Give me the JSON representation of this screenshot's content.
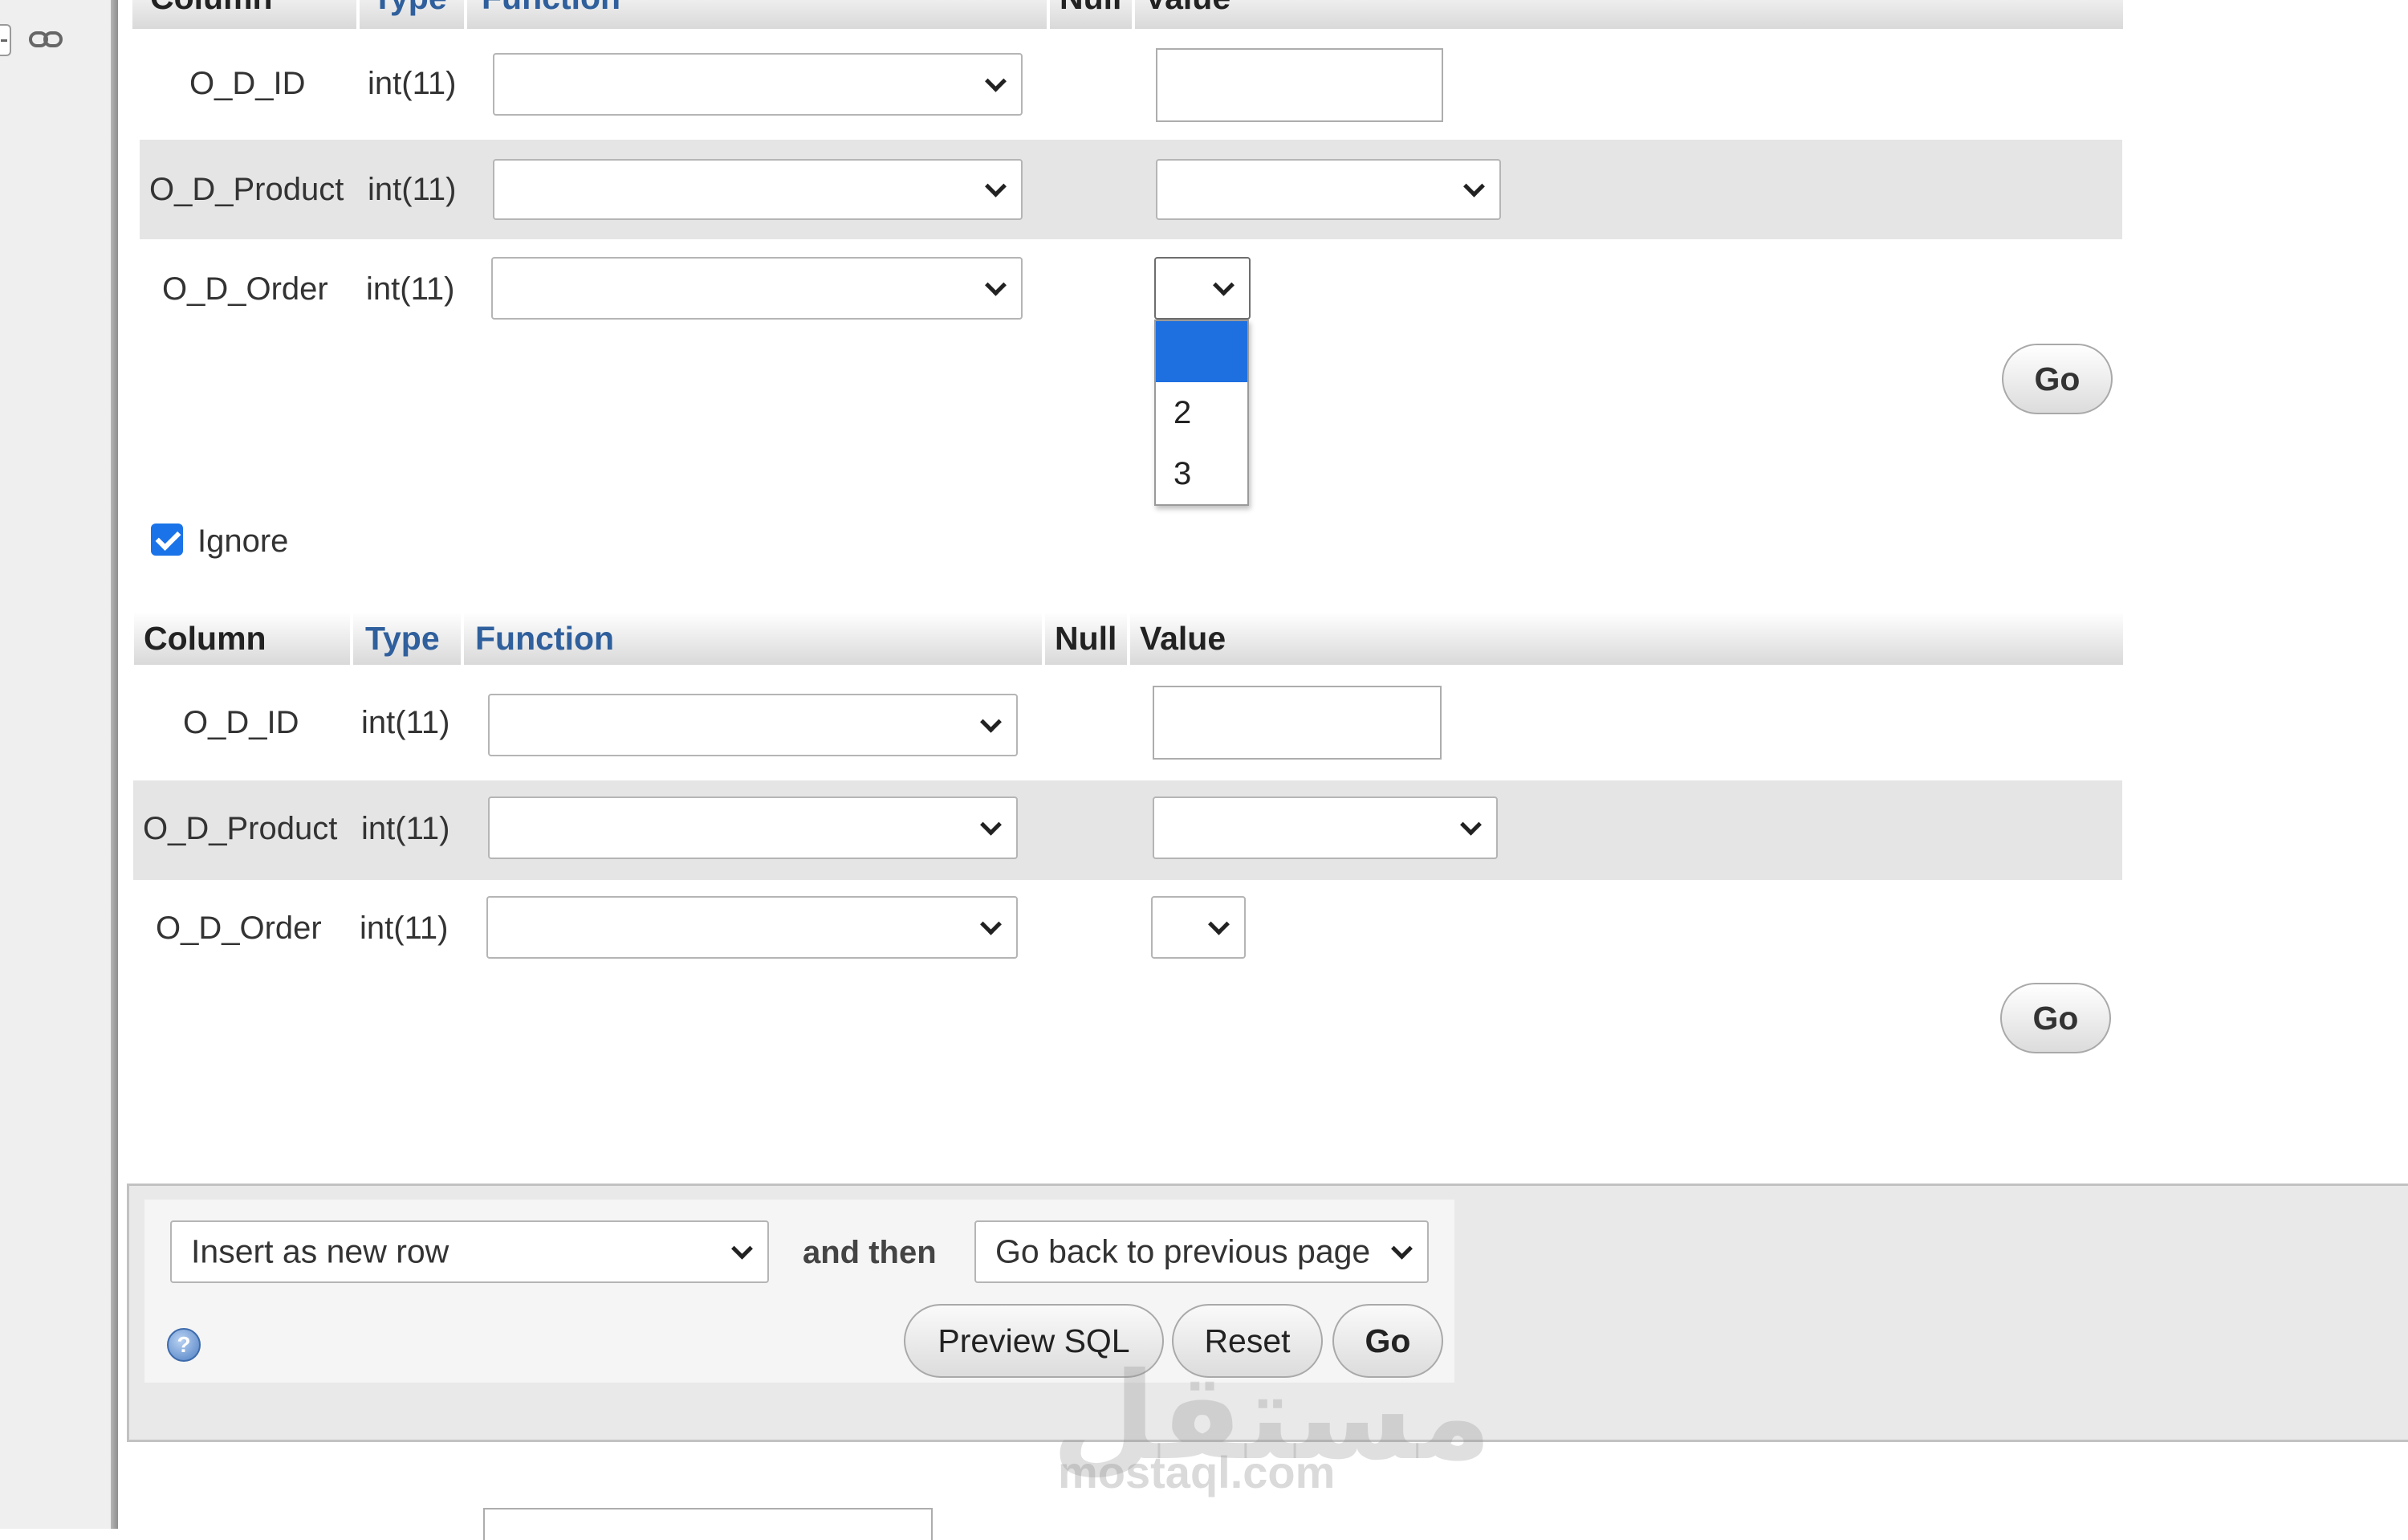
{
  "header": {
    "column": "Column",
    "type": "Type",
    "function": "Function",
    "null": "Null",
    "value": "Value"
  },
  "form1": {
    "rows": [
      {
        "column": "O_D_ID",
        "type": "int(11)",
        "function": "",
        "value": ""
      },
      {
        "column": "O_D_Product",
        "type": "int(11)",
        "function": "",
        "value": ""
      },
      {
        "column": "O_D_Order",
        "type": "int(11)",
        "function": "",
        "value": ""
      }
    ],
    "dropdown_options": [
      "",
      "2",
      "3"
    ],
    "go_label": "Go"
  },
  "ignore": {
    "label": "Ignore",
    "checked": true
  },
  "form2": {
    "rows": [
      {
        "column": "O_D_ID",
        "type": "int(11)",
        "function": "",
        "value": ""
      },
      {
        "column": "O_D_Product",
        "type": "int(11)",
        "function": "",
        "value": ""
      },
      {
        "column": "O_D_Order",
        "type": "int(11)",
        "function": "",
        "value": ""
      }
    ],
    "go_label": "Go"
  },
  "actions": {
    "insert_mode": "Insert as new row",
    "and_then": "and then",
    "after_insert": "Go back to previous page",
    "preview_sql": "Preview SQL",
    "reset": "Reset",
    "go": "Go",
    "help_icon": "help-icon"
  },
  "watermark": {
    "arabic": "مستقل",
    "latin": "mostaql.com"
  },
  "colors": {
    "checkbox": "#1a73e8",
    "dropdown_selected": "#1e6fe0",
    "header_blue": "#2f5f9c"
  }
}
